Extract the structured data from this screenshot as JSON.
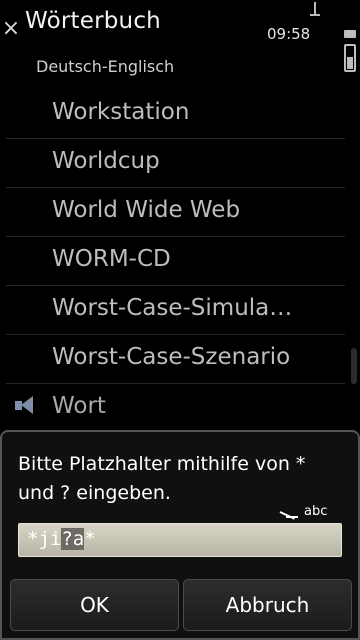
{
  "titlebar": {
    "title": "Wörterbuch",
    "time": "09:58",
    "close_icon": "×"
  },
  "subtitle": "Deutsch-Englisch",
  "list": {
    "items": [
      "Workstation",
      "Worldcup",
      "World Wide Web",
      "WORM-CD",
      "Worst-Case-Simula…",
      "Worst-Case-Szenario"
    ],
    "partial_item": "Wort"
  },
  "dialog": {
    "prompt": "Bitte Platzhalter mithilfe von * und ? eingeben.",
    "input_mode": "abc",
    "input_value_before": "*ji",
    "input_value_selected": "?a",
    "input_value_after": "*",
    "ok_label": "OK",
    "cancel_label": "Abbruch"
  },
  "colors": {
    "background": "#000000",
    "list_text": "#bdbdbd",
    "dialog_bg": "#101010",
    "field_bg": "#c9c5b6"
  }
}
